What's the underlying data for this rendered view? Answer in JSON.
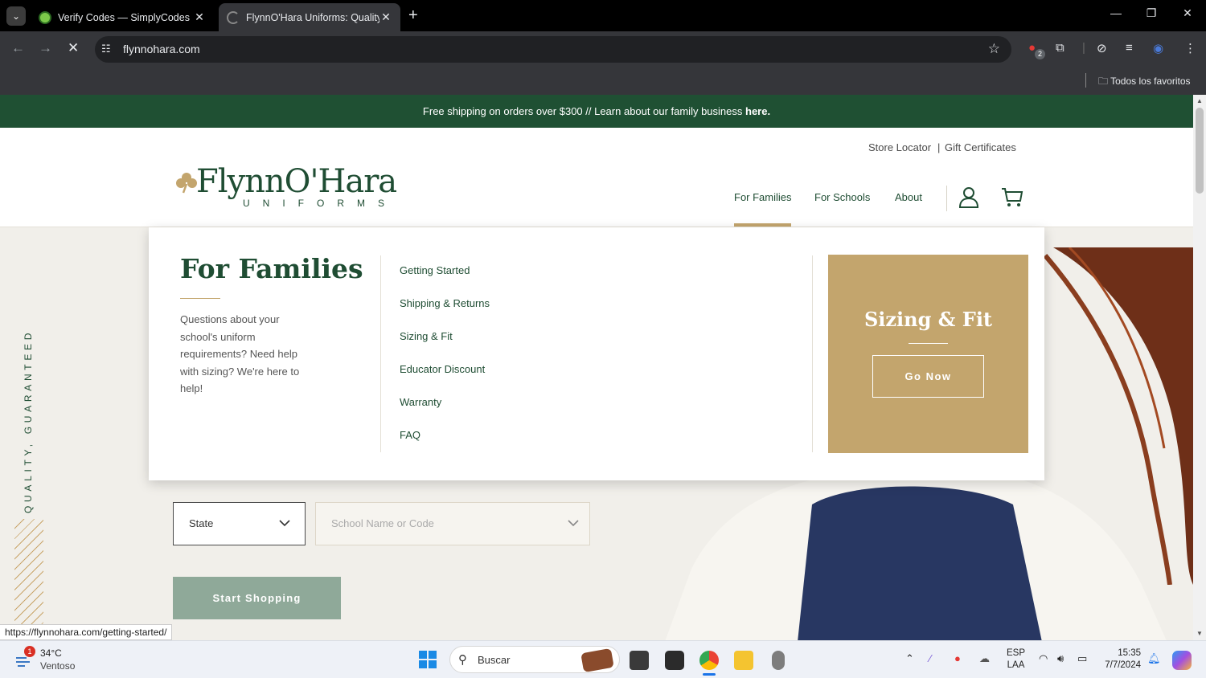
{
  "browser": {
    "tabs": [
      {
        "title": "Verify Codes — SimplyCodes",
        "active": false
      },
      {
        "title": "FlynnO'Hara Uniforms: Quality",
        "active": true
      }
    ],
    "url": "flynnohara.com",
    "extension_badge": "2",
    "bookmarks_label": "Todos los favoritos",
    "status_url": "https://flynnohara.com/getting-started/"
  },
  "site": {
    "promo_text": "Free shipping on orders over $300 // Learn about our family business ",
    "promo_link": "here.",
    "utility_links": [
      "Store Locator",
      "Gift Certificates"
    ],
    "utility_sep": "|",
    "logo_main": "FlynnO'Hara",
    "logo_sub": "UNIFORMS",
    "nav": [
      "For Families",
      "For Schools",
      "About"
    ],
    "side_text": "QUALITY, GUARANTEED",
    "dropdown": {
      "title": "For Families",
      "description": "Questions about your school's uniform requirements? Need help with sizing? We're here to help!",
      "links": [
        "Getting Started",
        "Shipping & Returns",
        "Sizing & Fit",
        "Educator Discount",
        "Warranty",
        "FAQ"
      ],
      "card_title": "Sizing & Fit",
      "card_button": "Go Now"
    },
    "form": {
      "state_value": "State",
      "school_placeholder": "School Name or Code",
      "start_button": "Start Shopping"
    },
    "colors": {
      "brand_green": "#1f5033",
      "gold": "#c3a56d",
      "sage": "#8fa999"
    }
  },
  "taskbar": {
    "weather_badge": "1",
    "temperature": "34°C",
    "condition": "Ventoso",
    "search_label": "Buscar",
    "lang_top": "ESP",
    "lang_bottom": "LAA",
    "time": "15:35",
    "date": "7/7/2024"
  }
}
